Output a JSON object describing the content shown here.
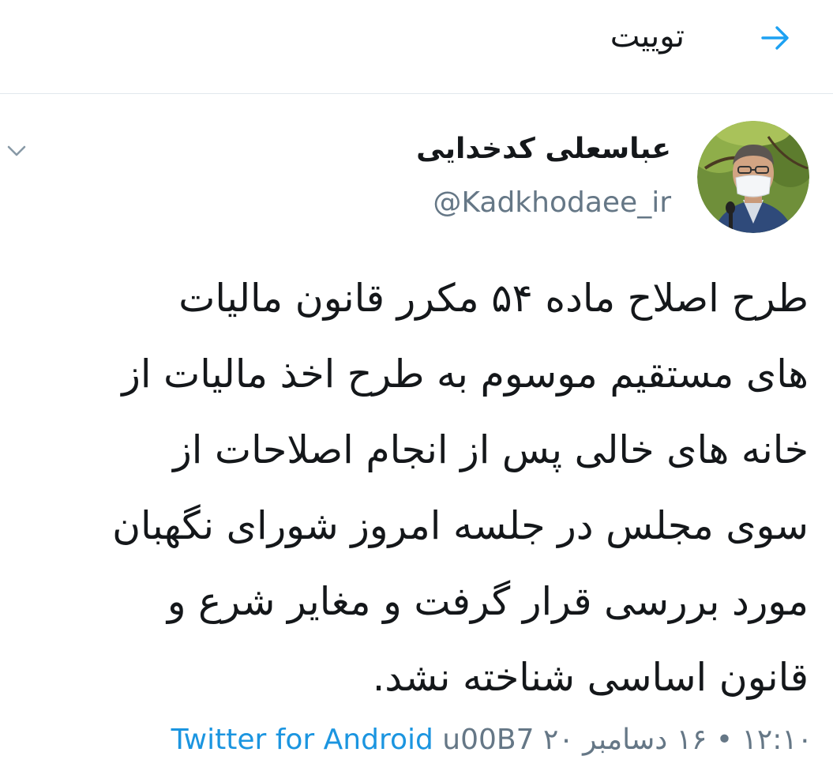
{
  "header": {
    "title": "توییت",
    "back_icon": "arrow-right-icon",
    "accent_color": "#1da1f2"
  },
  "tweet": {
    "display_name": "عباسعلی کدخدایی",
    "handle": "@Kadkhodaee_ir",
    "avatar_icon": "profile-photo",
    "menu_icon": "chevron-down-icon",
    "text": "طرح اصلاح ماده ۵۴ مکرر قانون مالیات\nهای مستقیم موسوم به طرح اخذ مالیات از\nخانه های خالی پس از انجام اصلاحات از\nسوی مجلس در جلسه امروز شورای نگهبان\nمورد بررسی قرار گرفت و مغایر شرع و\nقانون اساسی شناخته نشد.",
    "source": "Twitter for Android",
    "separator": "u00B7",
    "date": "۱۲:۱۰ • ۱۶ دسامبر ۲۰"
  }
}
